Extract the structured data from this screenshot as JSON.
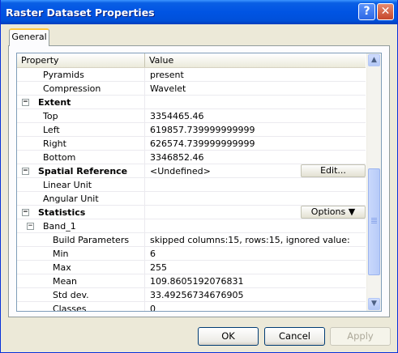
{
  "window": {
    "title": "Raster Dataset Properties",
    "help_glyph": "?",
    "close_glyph": "✕"
  },
  "tabs": [
    {
      "label": "General"
    }
  ],
  "grid": {
    "headers": {
      "property": "Property",
      "value": "Value"
    },
    "rows": [
      {
        "label": "Pyramids",
        "value": "present",
        "kind": "prop",
        "indent": 1
      },
      {
        "label": "Compression",
        "value": "Wavelet",
        "kind": "prop",
        "indent": 1
      },
      {
        "label": "Extent",
        "value": "",
        "kind": "category",
        "indent": 0,
        "expander": "−"
      },
      {
        "label": "Top",
        "value": "3354465.46",
        "kind": "prop",
        "indent": 1
      },
      {
        "label": "Left",
        "value": "619857.739999999999",
        "kind": "prop",
        "indent": 1
      },
      {
        "label": "Right",
        "value": "626574.739999999999",
        "kind": "prop",
        "indent": 1
      },
      {
        "label": "Bottom",
        "value": "3346852.46",
        "kind": "prop",
        "indent": 1
      },
      {
        "label": "Spatial Reference",
        "value": "<Undefined>",
        "kind": "category",
        "indent": 0,
        "expander": "−",
        "button": "Edit..."
      },
      {
        "label": "Linear Unit",
        "value": "",
        "kind": "prop",
        "indent": 1
      },
      {
        "label": "Angular Unit",
        "value": "",
        "kind": "prop",
        "indent": 1
      },
      {
        "label": "Statistics",
        "value": "",
        "kind": "category",
        "indent": 0,
        "expander": "−",
        "button": "Options ▼"
      },
      {
        "label": "Band_1",
        "value": "",
        "kind": "subgroup",
        "indent": 1,
        "expander": "−"
      },
      {
        "label": "Build Parameters",
        "value": "skipped columns:15, rows:15, ignored value:",
        "kind": "prop",
        "indent": 2
      },
      {
        "label": "Min",
        "value": "6",
        "kind": "prop",
        "indent": 2
      },
      {
        "label": "Max",
        "value": "255",
        "kind": "prop",
        "indent": 2
      },
      {
        "label": "Mean",
        "value": "109.8605192076831",
        "kind": "prop",
        "indent": 2
      },
      {
        "label": "Std dev.",
        "value": "33.49256734676905",
        "kind": "prop",
        "indent": 2
      },
      {
        "label": "Classes",
        "value": "0",
        "kind": "prop",
        "indent": 2
      }
    ]
  },
  "scrollbar": {
    "up_glyph": "▲",
    "down_glyph": "▼"
  },
  "buttons": {
    "ok": "OK",
    "cancel": "Cancel",
    "apply": "Apply"
  }
}
